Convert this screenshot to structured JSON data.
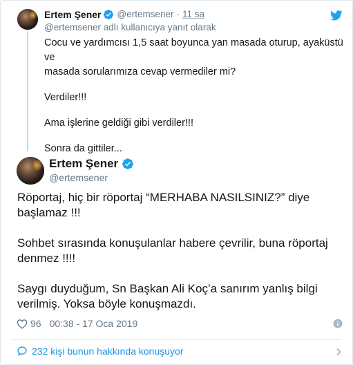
{
  "parent_tweet": {
    "name": "Ertem Şener",
    "handle": "@ertemsener",
    "separator": "·",
    "time": "11 sa",
    "reply_context": "@ertemsener adlı kullanıcıya yanıt olarak",
    "body": [
      "Cocu ve yardımcısı 1,5 saat boyunca yan masada oturup, ayaküstü ve\nmasada sorularımıza cevap vermediler mi?",
      "Verdiler!!!",
      "Ama işlerine geldiği gibi verdiler!!!",
      "Sonra da gittiler..."
    ]
  },
  "main_tweet": {
    "name": "Ertem Şener",
    "handle": "@ertemsener",
    "body": [
      "Röportaj, hiç bir röportaj “MERHABA NASILSINIZ?” diye başlamaz !!!",
      "Sohbet sırasında konuşulanlar habere çevrilir, buna röportaj denmez !!!!",
      "Saygı duyduğum, Sn Başkan Ali Koç’a sanırım yanlış bilgi verilmiş. Yoksa böyle konuşmazdı."
    ],
    "likes": "96",
    "timestamp": "00:38 - 17 Oca 2019",
    "conversation_label": "232 kişi bunun hakkında konuşuyor"
  },
  "icons": {
    "brand": "twitter-bird-icon",
    "verified": "verified-badge-icon",
    "like": "heart-icon",
    "info": "info-icon",
    "conversation": "speech-bubble-icon",
    "more": "chevron-right-icon"
  },
  "colors": {
    "brand_blue": "#1da1f2",
    "link_blue": "#1b95e0",
    "secondary_text": "#657786",
    "primary_text": "#14171a",
    "border": "#e1e8ed"
  }
}
